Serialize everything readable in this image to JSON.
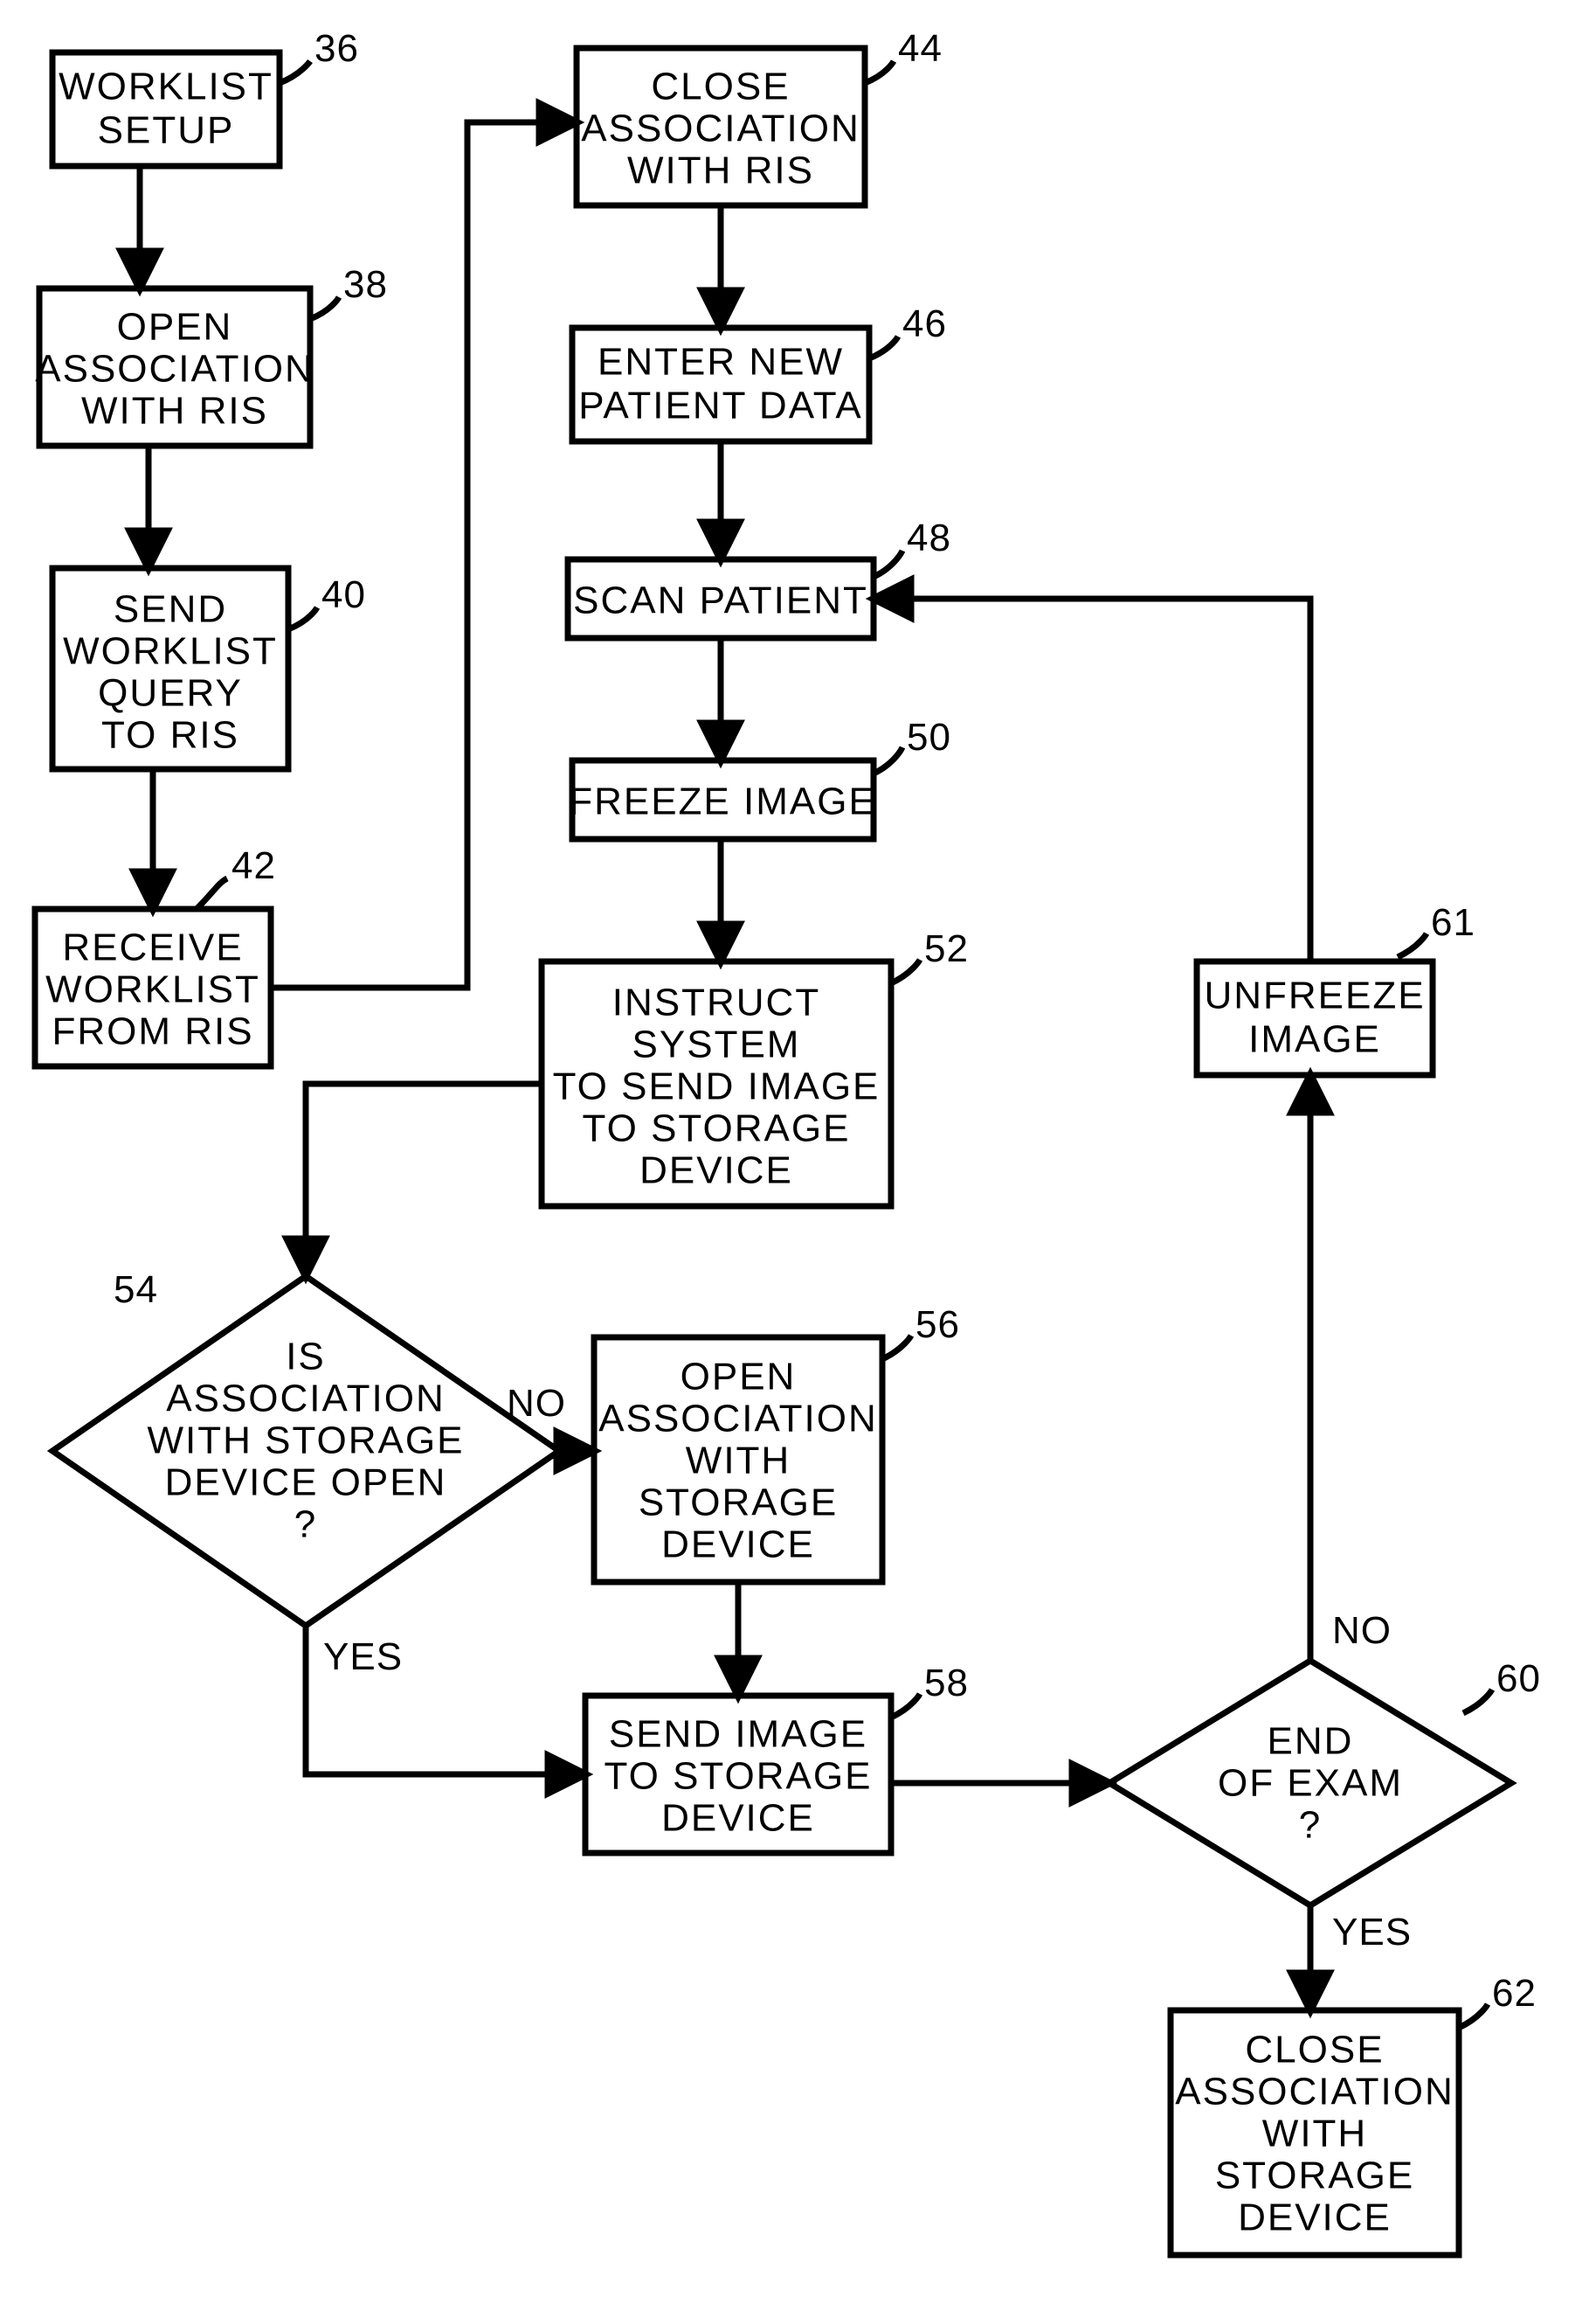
{
  "nodes": {
    "n36": {
      "label": "36",
      "lines": [
        "WORKLIST",
        "SETUP"
      ]
    },
    "n38": {
      "label": "38",
      "lines": [
        "OPEN",
        "ASSOCIATION",
        "WITH RIS"
      ]
    },
    "n40": {
      "label": "40",
      "lines": [
        "SEND",
        "WORKLIST",
        "QUERY",
        "TO RIS"
      ]
    },
    "n42": {
      "label": "42",
      "lines": [
        "RECEIVE",
        "WORKLIST",
        "FROM RIS"
      ]
    },
    "n44": {
      "label": "44",
      "lines": [
        "CLOSE",
        "ASSOCIATION",
        "WITH RIS"
      ]
    },
    "n46": {
      "label": "46",
      "lines": [
        "ENTER NEW",
        "PATIENT DATA"
      ]
    },
    "n48": {
      "label": "48",
      "lines": [
        "SCAN PATIENT"
      ]
    },
    "n50": {
      "label": "50",
      "lines": [
        "FREEZE IMAGE"
      ]
    },
    "n52": {
      "label": "52",
      "lines": [
        "INSTRUCT",
        "SYSTEM",
        "TO SEND IMAGE",
        "TO STORAGE",
        "DEVICE"
      ]
    },
    "n54": {
      "label": "54",
      "lines": [
        "IS",
        "ASSOCIATION",
        "WITH STORAGE",
        "DEVICE OPEN",
        "?"
      ]
    },
    "n56": {
      "label": "56",
      "lines": [
        "OPEN",
        "ASSOCIATION",
        "WITH",
        "STORAGE",
        "DEVICE"
      ]
    },
    "n58": {
      "label": "58",
      "lines": [
        "SEND IMAGE",
        "TO STORAGE",
        "DEVICE"
      ]
    },
    "n60": {
      "label": "60",
      "lines": [
        "END",
        "OF EXAM",
        "?"
      ]
    },
    "n61": {
      "label": "61",
      "lines": [
        "UNFREEZE",
        "IMAGE"
      ]
    },
    "n62": {
      "label": "62",
      "lines": [
        "CLOSE",
        "ASSOCIATION",
        "WITH",
        "STORAGE",
        "DEVICE"
      ]
    }
  },
  "edges": {
    "no54": "NO",
    "yes54": "YES",
    "no60": "NO",
    "yes60": "YES"
  }
}
